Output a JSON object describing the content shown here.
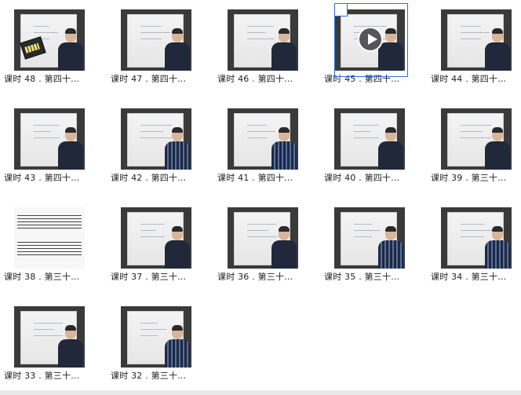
{
  "lessons": [
    {
      "label": "课时 48 . 第四十…",
      "variant": "prop"
    },
    {
      "label": "课时 47 . 第四十…",
      "variant": "board"
    },
    {
      "label": "课时 46 . 第四十…",
      "variant": "board"
    },
    {
      "label": "课时 45 . 第四十…",
      "variant": "selected"
    },
    {
      "label": "课时 44 . 第四十…",
      "variant": "board"
    },
    {
      "label": "课时 43 . 第四十…",
      "variant": "board"
    },
    {
      "label": "课时 42 . 第四十…",
      "variant": "plaid"
    },
    {
      "label": "课时 41 . 第四十…",
      "variant": "plaid"
    },
    {
      "label": "课时 40 . 第四十…",
      "variant": "board"
    },
    {
      "label": "课时 39 . 第三十…",
      "variant": "board"
    },
    {
      "label": "课时 38 . 第三十…",
      "variant": "sheet"
    },
    {
      "label": "课时 37 . 第三十…",
      "variant": "board"
    },
    {
      "label": "课时 36 . 第三十…",
      "variant": "board"
    },
    {
      "label": "课时 35 . 第三十…",
      "variant": "plaid"
    },
    {
      "label": "课时 34 . 第三十…",
      "variant": "plaid"
    },
    {
      "label": "课时 33 . 第三十…",
      "variant": "board"
    },
    {
      "label": "课时 32 . 第三十…",
      "variant": "plaid"
    }
  ],
  "icons": {
    "play": "play-icon",
    "checkbox": "checkbox-icon"
  },
  "colors": {
    "selection": "#2f6fd6",
    "label": "#222222"
  }
}
